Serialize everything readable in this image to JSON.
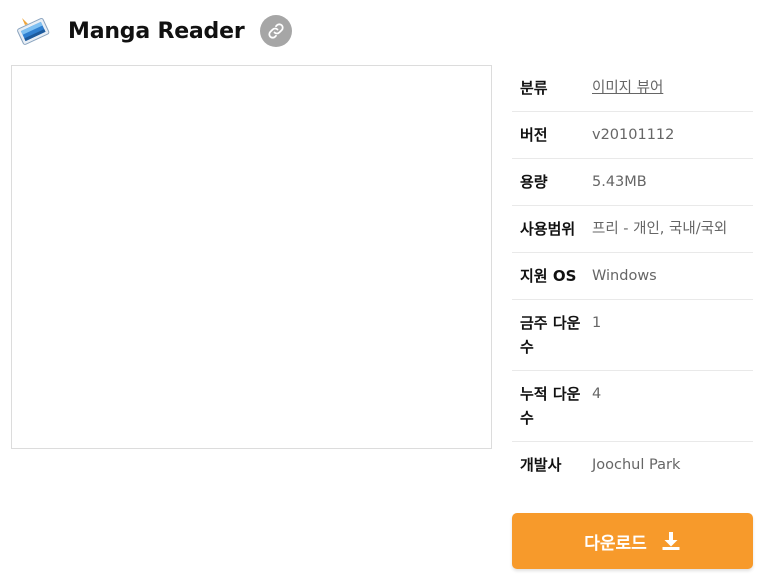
{
  "header": {
    "title": "Manga Reader",
    "app_icon": "manga-reader-app-icon",
    "link_icon": "link-icon"
  },
  "info": {
    "rows": [
      {
        "key": "분류",
        "value": "이미지 뷰어"
      },
      {
        "key": "버전",
        "value": "v20101112"
      },
      {
        "key": "용량",
        "value": "5.43MB"
      },
      {
        "key": "사용범위",
        "value": "프리 - 개인, 국내/국외"
      },
      {
        "key": "지원 OS",
        "value": "Windows"
      },
      {
        "key": "금주 다운수",
        "value": "1"
      },
      {
        "key": "누적 다운수",
        "value": "4"
      },
      {
        "key": "개발사",
        "value": "Joochul Park"
      }
    ]
  },
  "download": {
    "label": "다운로드",
    "icon": "download-icon"
  },
  "colors": {
    "accent": "#f79a2b",
    "link_button_bg": "#a6a6a6"
  }
}
